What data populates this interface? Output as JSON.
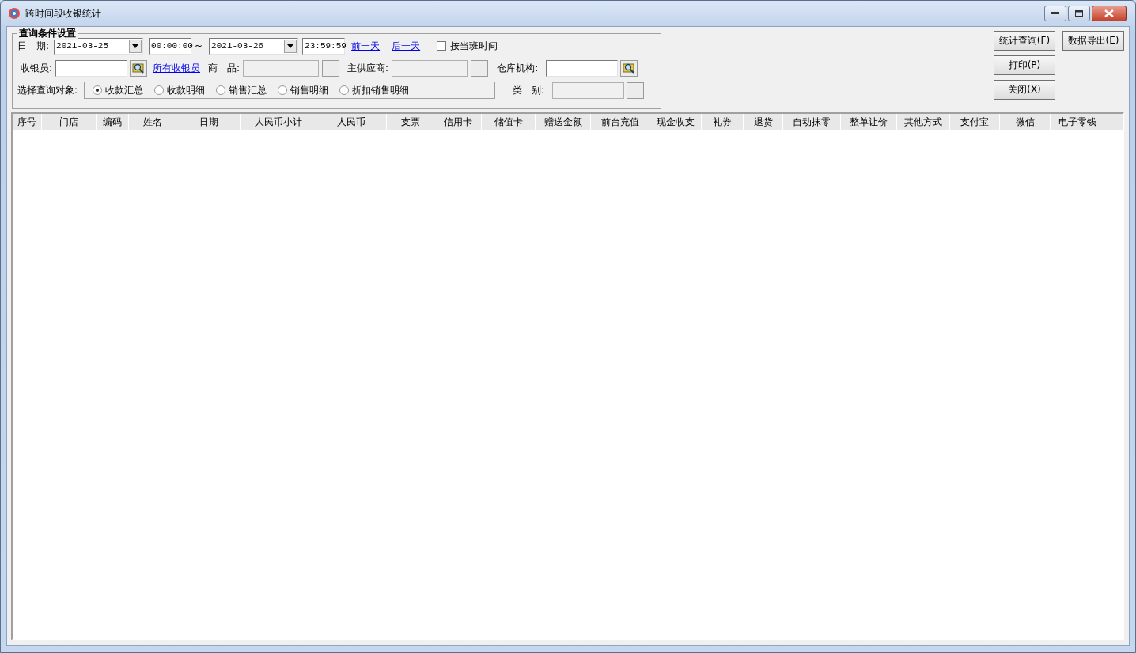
{
  "window": {
    "title": "跨时间段收银统计"
  },
  "query_conditions": {
    "title": "查询条件设置",
    "date": {
      "label": "日　期:",
      "start_date": "2021-03-25",
      "start_time": "00:00:00",
      "separator": "~",
      "end_date": "2021-03-26",
      "end_time": "23:59:59"
    },
    "day_links": [
      "前一天",
      "后一天"
    ],
    "shift_time": {
      "label": "按当班时间",
      "checked": false
    },
    "cashier": {
      "label": "收银员:",
      "disabled": false
    },
    "all_cashiers_link": "所有收银员",
    "product": {
      "label": "商　品:",
      "disabled": true
    },
    "supplier": {
      "label": "主供应商:",
      "disabled": true
    },
    "warehouse": {
      "label": "仓库机构:",
      "disabled": false
    },
    "query_target": {
      "label": "选择查询对象:",
      "options": [
        {
          "label": "收款汇总",
          "selected": true
        },
        {
          "label": "收款明细",
          "selected": false
        },
        {
          "label": "销售汇总",
          "selected": false
        },
        {
          "label": "销售明细",
          "selected": false
        },
        {
          "label": "折扣销售明细",
          "selected": false
        }
      ]
    },
    "category": {
      "label": "类　别:",
      "disabled": true
    }
  },
  "buttons": [
    "统计查询(F)",
    "数据导出(E)",
    "打印(P)",
    "关闭(X)"
  ],
  "table": {
    "columns": [
      "序号",
      "门店",
      "编码",
      "姓名",
      "日期",
      "人民币小计",
      "人民币",
      "支票",
      "信用卡",
      "储值卡",
      "赠送金额",
      "前台充值",
      "现金收支",
      "礼券",
      "退货",
      "自动抹零",
      "整单让价",
      "其他方式",
      "支付宝",
      "微信",
      "电子零钱"
    ]
  }
}
